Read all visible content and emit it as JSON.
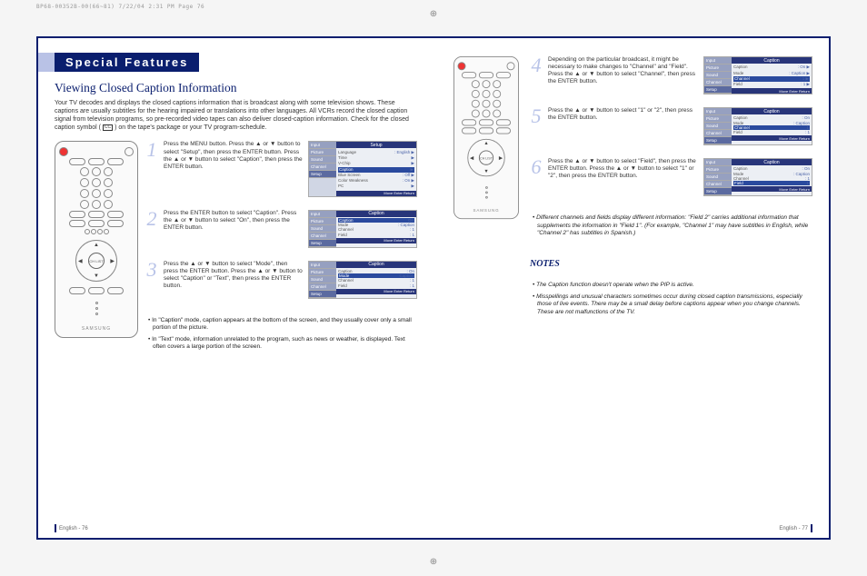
{
  "print_header": "BP68-00352B-00(66~81)  7/22/04  2:31 PM  Page 76",
  "header_title": "Special Features",
  "subtitle": "Viewing Closed Caption Information",
  "intro": "Your TV decodes and displays the closed captions information that is broadcast along with some television shows. These captions are usually subtitles for the hearing impaired or translations into other languages. All VCRs record the closed caption signal from television programs, so pre-recorded video tapes can also deliver closed-caption information. Check for the closed caption symbol (",
  "intro_sym": "CC",
  "intro_tail": ") on the tape's package or your TV program-schedule.",
  "steps_left": [
    {
      "num": "1",
      "text": "Press the MENU button.\nPress the ▲ or ▼ button to select \"Setup\", then press the ENTER button.\nPress the ▲ or ▼ button to select \"Caption\", then press the ENTER button."
    },
    {
      "num": "2",
      "text": "Press the ENTER button to select \"Caption\".\nPress the ▲ or ▼ button to select \"On\", then press the ENTER button."
    },
    {
      "num": "3",
      "text": "Press the ▲ or ▼ button to select \"Mode\", then press the ENTER button.\nPress the ▲ or ▼ button to select \"Caption\" or \"Text\", then press the ENTER button."
    }
  ],
  "left_notes": [
    "In \"Caption\" mode, caption appears at the bottom of the screen, and they usually cover only a small portion of the picture.",
    "In \"Text\" mode, information unrelated to the program, such as news or weather, is displayed. Text often covers a large portion of the screen."
  ],
  "steps_right": [
    {
      "num": "4",
      "text": "Depending on the particular broadcast, it might be necessary to make changes to \"Channel\" and \"Field\". Press the ▲ or ▼ button to select \"Channel\", then press the ENTER button."
    },
    {
      "num": "5",
      "text": "Press the ▲ or ▼ button to select \"1\" or \"2\", then press the ENTER button."
    },
    {
      "num": "6",
      "text": "Press the ▲ or ▼ button to select \"Field\", then press the ENTER button.\nPress the ▲ or ▼ button to select \"1\" or \"2\", then press the ENTER button."
    }
  ],
  "right_italic_note": "Different channels and fields display different information: \"Field 2\" carries additional information that supplements the information in \"Field 1\". (For example, \"Channel 1\" may have subtitles in English, while \"Channel 2\" has subtitles in Spanish.)",
  "notes_head": "NOTES",
  "right_notes": [
    "The Caption function doesn't operate when the PIP is active.",
    "Misspellings and unusual characters sometimes occur during closed caption transmissions, especially those of live events. There may be a small delay before captions appear when you change channels. These are not malfunctions of the TV."
  ],
  "footer_left": "English - 76",
  "footer_right": "English - 77",
  "osd": {
    "side_tabs": [
      "Input",
      "Picture",
      "Sound",
      "Channel",
      "Setup"
    ],
    "footer": "Move    Enter    Return",
    "setup": {
      "title": "Setup",
      "rows": [
        {
          "k": "Language",
          "v": ": English",
          "tri": "▶"
        },
        {
          "k": "Time",
          "v": "",
          "tri": "▶"
        },
        {
          "k": "V-Chip",
          "v": "",
          "tri": "▶"
        },
        {
          "k": "Caption",
          "v": "",
          "hl": true,
          "tri": "▶"
        },
        {
          "k": "Blue Screen",
          "v": ": Off",
          "tri": "▶"
        },
        {
          "k": "Color Weakness",
          "v": ": On",
          "tri": "▶"
        },
        {
          "k": "PC",
          "v": "",
          "tri": "▶"
        }
      ]
    },
    "cap_on": {
      "title": "Caption",
      "rows": [
        {
          "k": "Caption",
          "v": "On",
          "hl": true,
          "tri": ""
        },
        {
          "k": "Mode",
          "v": ": Caption",
          "tri": ""
        },
        {
          "k": "Channel",
          "v": ": 1",
          "tri": ""
        },
        {
          "k": "Field",
          "v": ": 1",
          "tri": ""
        }
      ]
    },
    "cap_mode": {
      "title": "Caption",
      "rows": [
        {
          "k": "Caption",
          "v": ": On",
          "tri": ""
        },
        {
          "k": "Mode",
          "v": "Caption",
          "hl": true,
          "tri": ""
        },
        {
          "k": "Channel",
          "v": ": 1",
          "tri": ""
        },
        {
          "k": "Field",
          "v": ": 1",
          "tri": ""
        }
      ]
    },
    "cap_channel_list": {
      "title": "Caption",
      "rows": [
        {
          "k": "Caption",
          "v": ": On",
          "tri": "▶"
        },
        {
          "k": "Mode",
          "v": ": Caption",
          "tri": "▶"
        },
        {
          "k": "Channel",
          "v": ": 1",
          "hl": true,
          "tri": "▶"
        },
        {
          "k": "Field",
          "v": ": 1",
          "tri": "▶"
        }
      ]
    },
    "cap_channel_sel": {
      "title": "Caption",
      "rows": [
        {
          "k": "Caption",
          "v": ": On",
          "tri": ""
        },
        {
          "k": "Mode",
          "v": ": Caption",
          "tri": ""
        },
        {
          "k": "Channel",
          "v": "1",
          "hl": true,
          "tri": ""
        },
        {
          "k": "Field",
          "v": ": 1",
          "tri": ""
        }
      ]
    },
    "cap_field_sel": {
      "title": "Caption",
      "rows": [
        {
          "k": "Caption",
          "v": ": On",
          "tri": ""
        },
        {
          "k": "Mode",
          "v": ": Caption",
          "tri": ""
        },
        {
          "k": "Channel",
          "v": ": 1",
          "tri": ""
        },
        {
          "k": "Field",
          "v": "1",
          "hl": true,
          "tri": ""
        }
      ]
    }
  },
  "remote_brand": "SAMSUNG",
  "dpad_center": "CH LIST"
}
